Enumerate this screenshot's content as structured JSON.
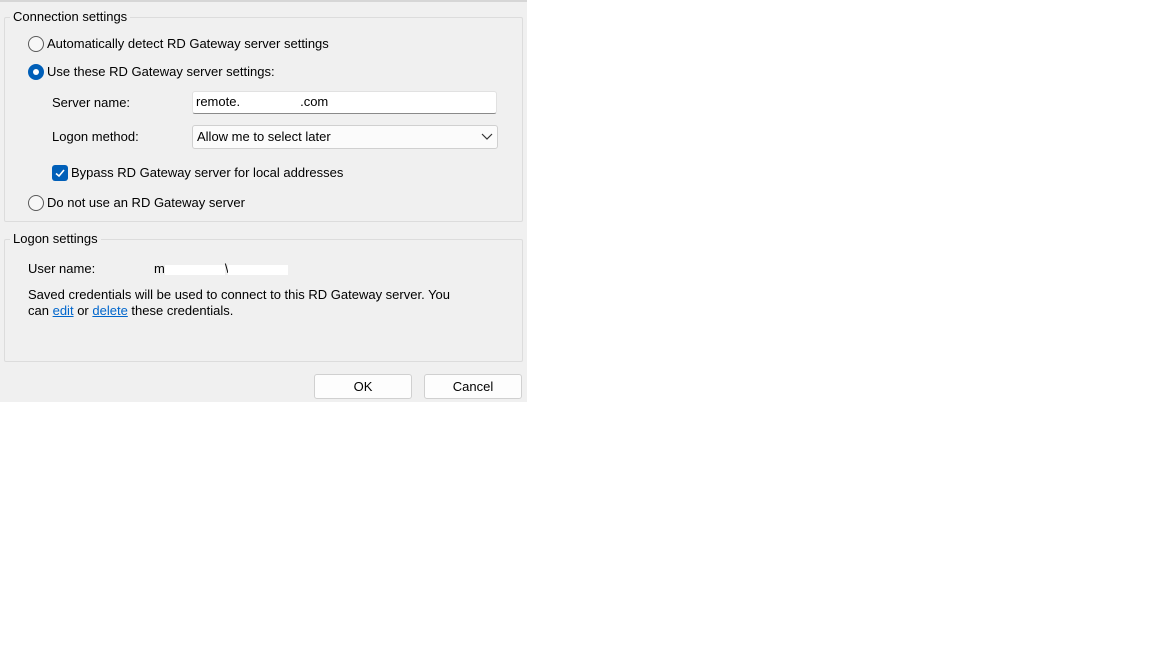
{
  "connection": {
    "legend": "Connection settings",
    "auto_detect_label": "Automatically detect RD Gateway server settings",
    "use_settings_label": "Use these RD Gateway server settings:",
    "server_name_label": "Server name:",
    "server_name_value_start": "remote.",
    "server_name_value_end": ".com",
    "logon_method_label": "Logon method:",
    "logon_method_value": "Allow me to select later",
    "bypass_label": "Bypass RD Gateway server for local addresses",
    "no_gateway_label": "Do not use an RD Gateway server"
  },
  "logon": {
    "legend": "Logon settings",
    "user_name_label": "User name:",
    "user_name_value_start": "m",
    "user_name_value_mid": "\\",
    "credentials_text_1": "Saved credentials will be used to connect to this RD Gateway server. You",
    "credentials_text_2_prefix": "can",
    "edit_link": "edit",
    "or_text": "or",
    "delete_link": "delete",
    "credentials_text_2_suffix": "these credentials."
  },
  "buttons": {
    "ok": "OK",
    "cancel": "Cancel"
  },
  "selection": {
    "gateway_mode": "use-these-settings",
    "bypass_local": true
  },
  "colors": {
    "accent": "#005fb8",
    "link": "#0066cc",
    "dialog_bg": "#f0f0f0"
  }
}
